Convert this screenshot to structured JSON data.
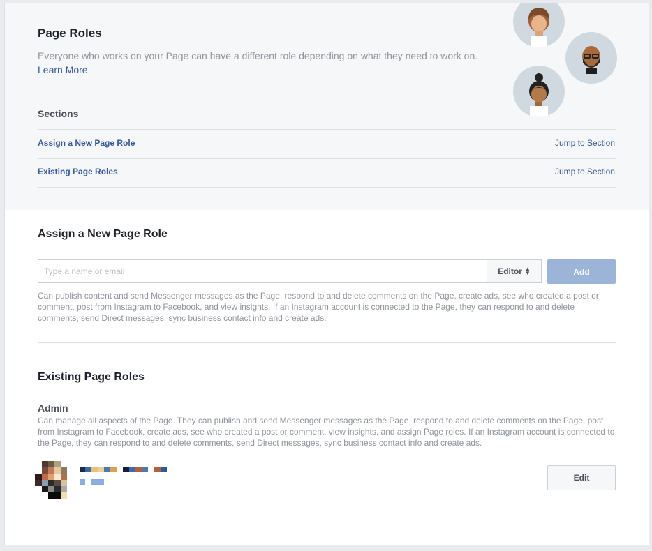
{
  "header": {
    "title": "Page Roles",
    "description": "Everyone who works on your Page can have a different role depending on what they need to work on.",
    "learn_more": "Learn More"
  },
  "sections": {
    "title": "Sections",
    "items": [
      {
        "label": "Assign a New Page Role",
        "jump": "Jump to Section"
      },
      {
        "label": "Existing Page Roles",
        "jump": "Jump to Section"
      }
    ]
  },
  "assign": {
    "title": "Assign a New Page Role",
    "input_placeholder": "Type a name or email",
    "role_select": "Editor",
    "add_label": "Add",
    "description": "Can publish content and send Messenger messages as the Page, respond to and delete comments on the Page, create ads, see who created a post or comment, post from Instagram to Facebook, and view insights. If an Instagram account is connected to the Page, they can respond to and delete comments, send Direct messages, sync business contact info and create ads."
  },
  "existing": {
    "title": "Existing Page Roles",
    "admin_title": "Admin",
    "admin_description": "Can manage all aspects of the Page. They can publish and send Messenger messages as the Page, respond to and delete comments on the Page, post from Instagram to Facebook, create ads, see who created a post or comment, view insights, and assign Page roles. If an Instagram account is connected to the Page, they can respond to and delete comments, send Direct messages, sync business contact info and create ads.",
    "edit_label": "Edit"
  },
  "colors": {
    "link": "#365899",
    "add_button": "#9cb4d8",
    "avatar_bg": "#d0d9e0"
  },
  "icons": {
    "updown": "sort-arrows-icon"
  }
}
